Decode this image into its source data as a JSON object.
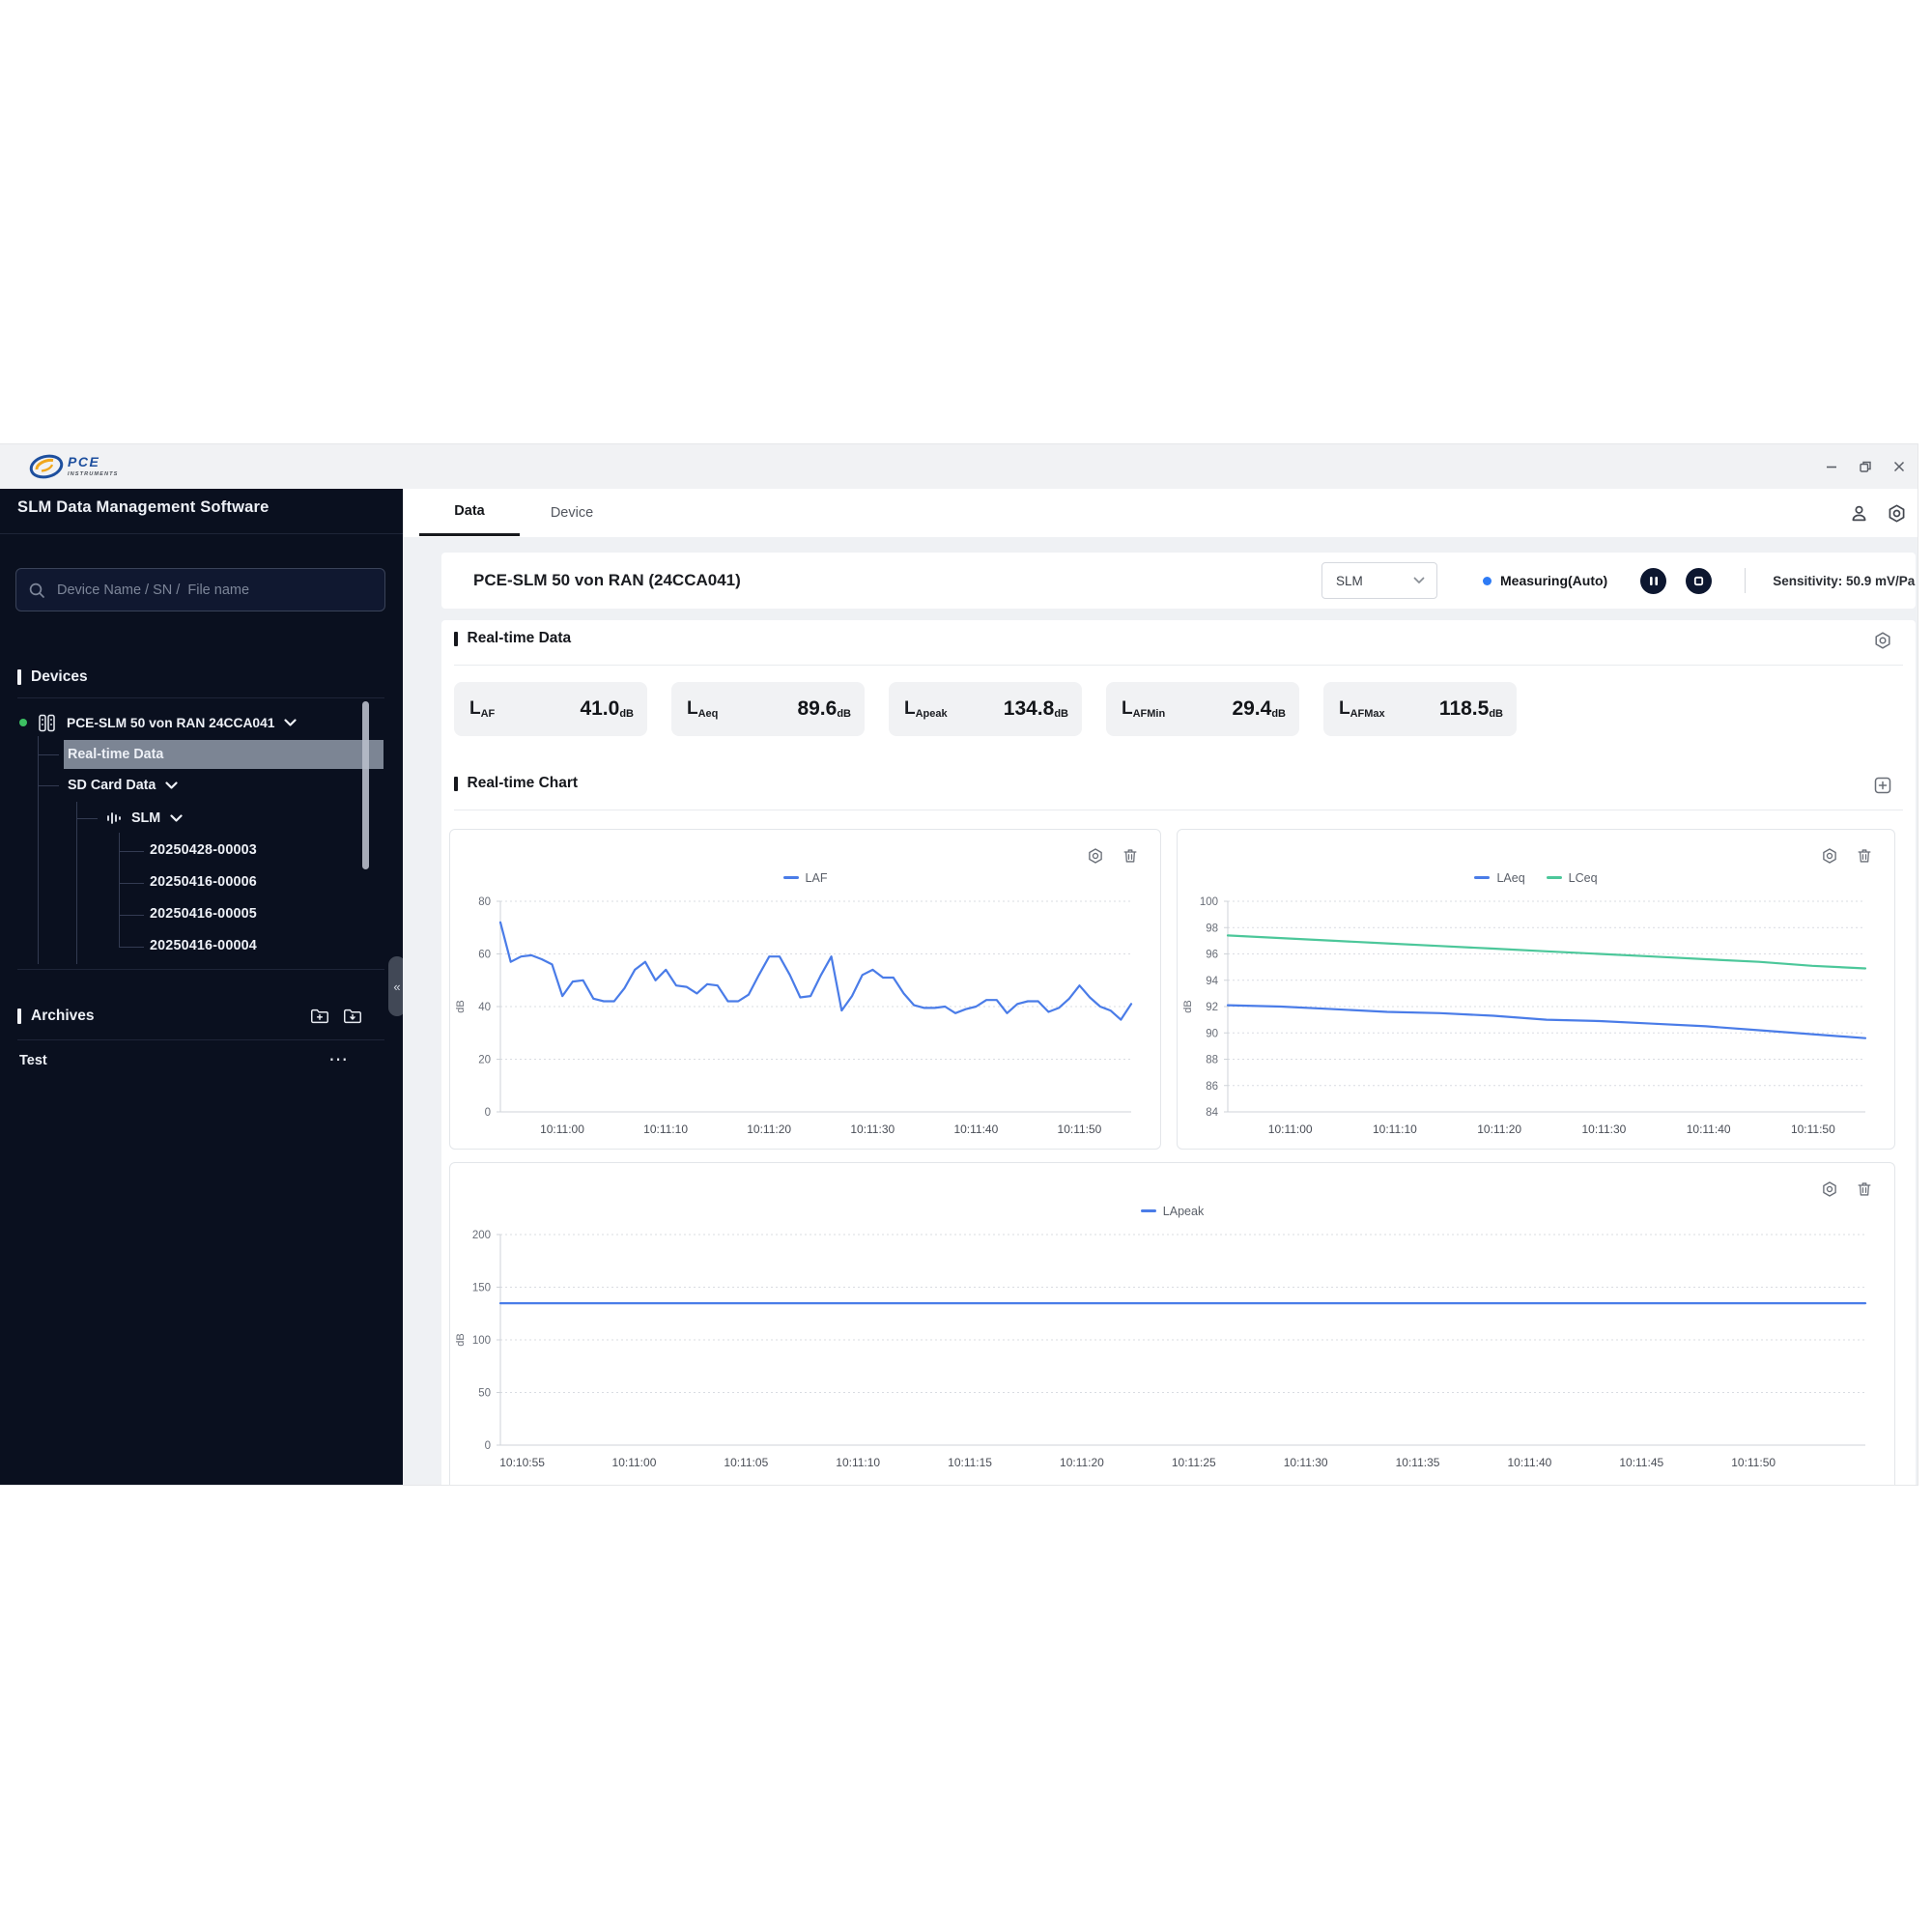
{
  "app": {
    "title": "SLM Data Management Software"
  },
  "titlebar": {
    "brand": "PCE",
    "brand_sub": "INSTRUMENTS"
  },
  "search": {
    "placeholder": "Device Name / SN /  File name"
  },
  "icons": {
    "more": "⋯",
    "collapse": "«"
  },
  "sidebar": {
    "devices_title": "Devices",
    "device": {
      "name": "PCE-SLM 50 von RAN 24CCA041"
    },
    "tree": {
      "realtime": "Real-time Data",
      "sdcard": "SD Card Data",
      "slm": "SLM",
      "files": [
        "20250428-00003",
        "20250416-00006",
        "20250416-00005",
        "20250416-00004"
      ]
    },
    "archives_title": "Archives",
    "archive_items": [
      {
        "name": "Test"
      }
    ]
  },
  "tabs": {
    "data": "Data",
    "device": "Device"
  },
  "header": {
    "title": "PCE-SLM 50 von RAN (24CCA041)",
    "mode": "SLM",
    "status": "Measuring(Auto)",
    "sensitivity": "Sensitivity: 50.9 mV/Pa"
  },
  "sections": {
    "realtime_data": "Real-time Data",
    "realtime_chart": "Real-time Chart"
  },
  "metrics": [
    {
      "base": "L",
      "sub": "AF",
      "value": "41.0",
      "unit": "dB"
    },
    {
      "base": "L",
      "sub": "Aeq",
      "value": "89.6",
      "unit": "dB"
    },
    {
      "base": "L",
      "sub": "Apeak",
      "value": "134.8",
      "unit": "dB"
    },
    {
      "base": "L",
      "sub": "AFMin",
      "value": "29.4",
      "unit": "dB"
    },
    {
      "base": "L",
      "sub": "AFMax",
      "value": "118.5",
      "unit": "dB"
    }
  ],
  "colors": {
    "accent_blue": "#2e7bf5",
    "chart_blue": "#4a7ce8",
    "chart_green": "#4cc79a",
    "status_green": "#3cc062",
    "sidebar_bg": "#0a101f",
    "selected_row": "#7c8594"
  },
  "chart_data": [
    {
      "type": "line",
      "title": "",
      "ylabel": "dB",
      "ylim": [
        0,
        80
      ],
      "yticks": [
        80,
        60,
        40,
        20,
        0
      ],
      "grid": "dotted-horizontal",
      "legend_position": "top",
      "x_span": "10:10:54 - 10:11:55, 1 s interval",
      "x_ticks": [
        {
          "f": 0.098,
          "label": "10:11:00"
        },
        {
          "f": 0.262,
          "label": "10:11:10"
        },
        {
          "f": 0.426,
          "label": "10:11:20"
        },
        {
          "f": 0.59,
          "label": "10:11:30"
        },
        {
          "f": 0.754,
          "label": "10:11:40"
        },
        {
          "f": 0.918,
          "label": "10:11:50"
        }
      ],
      "series": [
        {
          "name": "LAF",
          "color": "#4a7ce8",
          "values": [
            72,
            57,
            59,
            59.5,
            58,
            56,
            44,
            49.5,
            50,
            43,
            42,
            42,
            47,
            54,
            57,
            50,
            54,
            48,
            47.5,
            45,
            48.5,
            48,
            42,
            42,
            44.5,
            52,
            59,
            59,
            52,
            43.5,
            44,
            52,
            59,
            38.5,
            44,
            52,
            54,
            51,
            51,
            45,
            40.5,
            39.5,
            39.5,
            40,
            37.5,
            39,
            40,
            42.5,
            42.5,
            37.5,
            41,
            42,
            42,
            38,
            39.5,
            43,
            48,
            43.5,
            40,
            38.5,
            35,
            41
          ]
        }
      ]
    },
    {
      "type": "line",
      "title": "",
      "ylabel": "dB",
      "ylim": [
        84,
        100
      ],
      "yticks": [
        100,
        98,
        96,
        94,
        92,
        90,
        88,
        86,
        84
      ],
      "grid": "dotted-horizontal",
      "legend_position": "top",
      "x_span": "10:10:54 - 10:11:55",
      "x_ticks": [
        {
          "f": 0.098,
          "label": "10:11:00"
        },
        {
          "f": 0.262,
          "label": "10:11:10"
        },
        {
          "f": 0.426,
          "label": "10:11:20"
        },
        {
          "f": 0.59,
          "label": "10:11:30"
        },
        {
          "f": 0.754,
          "label": "10:11:40"
        },
        {
          "f": 0.918,
          "label": "10:11:50"
        }
      ],
      "series": [
        {
          "name": "LAeq",
          "color": "#4a7ce8",
          "values": [
            92.1,
            92.0,
            91.8,
            91.6,
            91.5,
            91.3,
            91.0,
            90.9,
            90.7,
            90.5,
            90.2,
            89.9,
            89.6
          ]
        },
        {
          "name": "LCeq",
          "color": "#4cc79a",
          "values": [
            97.4,
            97.2,
            97.0,
            96.8,
            96.6,
            96.4,
            96.2,
            96.0,
            95.8,
            95.6,
            95.4,
            95.1,
            94.9
          ]
        }
      ]
    },
    {
      "type": "line",
      "title": "",
      "ylabel": "dB",
      "ylim": [
        0,
        200
      ],
      "yticks": [
        200,
        150,
        100,
        50,
        0
      ],
      "grid": "dotted-horizontal",
      "legend_position": "top",
      "x_span": "10:10:54 - 10:11:55",
      "x_ticks": [
        {
          "f": 0.016,
          "label": "10:10:55"
        },
        {
          "f": 0.098,
          "label": "10:11:00"
        },
        {
          "f": 0.18,
          "label": "10:11:05"
        },
        {
          "f": 0.262,
          "label": "10:11:10"
        },
        {
          "f": 0.344,
          "label": "10:11:15"
        },
        {
          "f": 0.426,
          "label": "10:11:20"
        },
        {
          "f": 0.508,
          "label": "10:11:25"
        },
        {
          "f": 0.59,
          "label": "10:11:30"
        },
        {
          "f": 0.672,
          "label": "10:11:35"
        },
        {
          "f": 0.754,
          "label": "10:11:40"
        },
        {
          "f": 0.836,
          "label": "10:11:45"
        },
        {
          "f": 0.918,
          "label": "10:11:50"
        }
      ],
      "series": [
        {
          "name": "LApeak",
          "color": "#4a7ce8",
          "values": [
            134.8,
            134.8
          ]
        }
      ]
    }
  ]
}
